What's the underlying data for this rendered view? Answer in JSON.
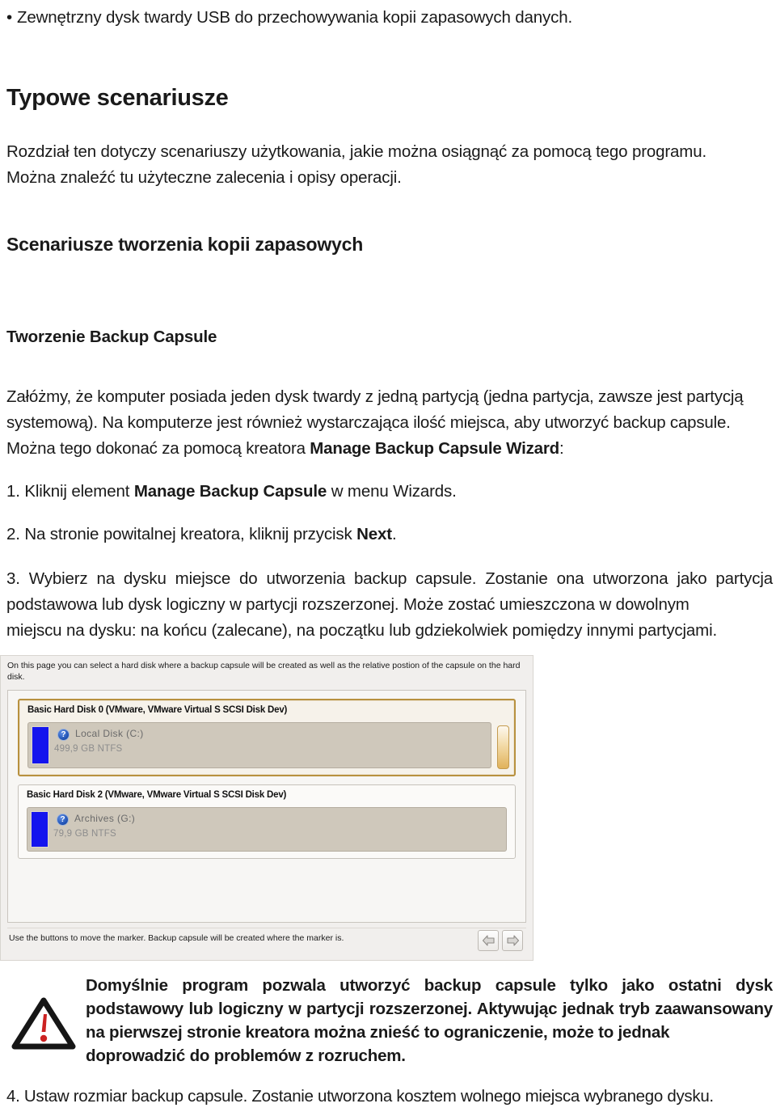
{
  "document": {
    "bullet_item": "Zewnętrzny dysk twardy USB do przechowywania kopii zapasowych danych.",
    "bullet_marker": "•",
    "heading_1": "Typowe scenariusze",
    "intro_line_1": "Rozdział ten dotyczy scenariuszy użytkowania, jakie można osiągnąć za pomocą tego programu.",
    "intro_line_2": "Można znaleźć tu użyteczne zalecenia i opisy operacji.",
    "heading_2": "Scenariusze tworzenia kopii zapasowych",
    "heading_3": "Tworzenie Backup Capsule",
    "assume_line_1": "Załóżmy, że komputer posiada jeden dysk twardy z jedną partycją (jedna partycja, zawsze jest partycją",
    "assume_line_2": "systemową). Na komputerze jest również wystarczająca ilość miejsca, aby utworzyć backup capsule.",
    "assume_line_3_pre": "Można tego dokonać za pomocą kreatora ",
    "assume_line_3_bold": "Manage Backup Capsule Wizard",
    "assume_line_3_post": ":",
    "steps": [
      {
        "number": "1.",
        "pre": " Kliknij element ",
        "bold": "Manage Backup Capsule",
        "post": " w menu Wizards."
      },
      {
        "number": "2.",
        "pre": " Na stronie powitalnej kreatora, kliknij przycisk ",
        "bold": "Next",
        "post": "."
      },
      {
        "number": "3.",
        "pre": " Wybierz na dysku miejsce do utworzenia backup capsule. Zostanie ona utworzona jako partycja podstawowa lub dysk logiczny w partycji rozszerzonej. Może zostać umieszczona w dowolnym",
        "last": "miejscu na dysku: na końcu (zalecane), na początku lub gdziekolwiek pomiędzy innymi partycjami."
      },
      {
        "number": "4.",
        "pre": " Ustaw rozmiar backup capsule. Zostanie utworzona kosztem wolnego miejsca wybranego dysku."
      }
    ],
    "warning": {
      "icon": "warning-triangle-icon",
      "line_1": "Domyślnie program pozwala utworzyć backup capsule tylko jako ostatni dysk podstawowy lub logiczny w partycji rozszerzonej. Aktywując jednak tryb zaawansowany na pierwszej stronie kreatora można znieść to ograniczenie, może to jednak",
      "line_2": "doprowadzić do problemów z rozruchem."
    }
  },
  "screenshot": {
    "description": "On this page you can select a hard disk where a backup capsule will be created as well as the relative postion of the capsule on the hard disk.",
    "disks": [
      {
        "title": "Basic Hard Disk 0 (VMware, VMware Virtual S SCSI Disk Dev)",
        "selected": true,
        "partition": {
          "icon_glyph": "?",
          "label": "Local Disk (C:)",
          "size": "499,9 GB NTFS",
          "color": "#1414ee"
        },
        "marker": "capsule-position-marker"
      },
      {
        "title": "Basic Hard Disk 2 (VMware, VMware Virtual S SCSI Disk Dev)",
        "selected": false,
        "partition": {
          "icon_glyph": "?",
          "label": "Archives (G:)",
          "size": "79,9 GB NTFS",
          "color": "#1414ee"
        },
        "marker": null
      }
    ],
    "footer_hint": "Use the buttons to move the marker. Backup capsule will be created where the marker is.",
    "nav_prev": "move-marker-left",
    "nav_next": "move-marker-right"
  },
  "colors": {
    "selection_border": "#b8913f",
    "partition_blue": "#1414ee",
    "marker_gold": "#e0b25b",
    "warning_red": "#cc2222"
  }
}
